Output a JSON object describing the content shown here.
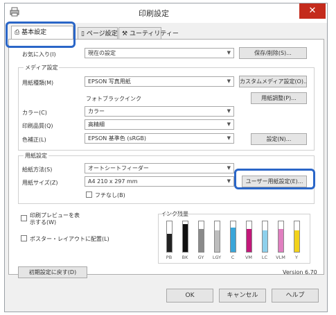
{
  "window": {
    "title": "印刷設定",
    "close_glyph": "✕"
  },
  "tabs": [
    {
      "label": "基本設定"
    },
    {
      "label": "ページ設定"
    },
    {
      "label": "ユーティリティー"
    }
  ],
  "favorites": {
    "label": "お気に入り(I)",
    "value": "現在の設定",
    "button": "保存/削除(S)..."
  },
  "media": {
    "group_title": "メディア設定",
    "paper_type_label": "用紙種類(M)",
    "paper_type_value": "EPSON 写真用紙",
    "custom_button": "カスタムメディア設定(O)...",
    "ink_text": "フォトブラックインク",
    "adjust_button": "用紙調整(P)...",
    "color_label": "カラー(C)",
    "color_value": "カラー",
    "quality_label": "印刷品質(Q)",
    "quality_value": "高精細",
    "mode_label": "色補正(L)",
    "mode_value": "EPSON 基準色 (sRGB)",
    "settings_button": "設定(N)..."
  },
  "paper": {
    "group_title": "用紙設定",
    "source_label": "給紙方法(S)",
    "source_value": "オートシートフィーダー",
    "size_label": "用紙サイズ(Z)",
    "size_value": "A4 210 x 297 mm",
    "user_size_button": "ユーザー用紙設定(E)...",
    "borderless_label": "フチなし(B)",
    "borderless_checked": false
  },
  "options": {
    "preview_label": "印刷プレビューを表示する(W)",
    "layout_label": "ポスター・レイアウトに配置(L)"
  },
  "ink_levels": {
    "title": "インク残量",
    "inks": [
      {
        "name": "PB",
        "color": "#222222",
        "level": 0.6
      },
      {
        "name": "BK",
        "color": "#111111",
        "level": 0.9
      },
      {
        "name": "GY",
        "color": "#8a8a8a",
        "level": 0.75
      },
      {
        "name": "LGY",
        "color": "#bdbdbd",
        "level": 0.7
      },
      {
        "name": "C",
        "color": "#3aa6d9",
        "level": 0.8
      },
      {
        "name": "VM",
        "color": "#c2187a",
        "level": 0.75
      },
      {
        "name": "LC",
        "color": "#8ed0ec",
        "level": 0.7
      },
      {
        "name": "VLM",
        "color": "#e07fc0",
        "level": 0.75
      },
      {
        "name": "Y",
        "color": "#f2d21b",
        "level": 0.7
      }
    ]
  },
  "footer": {
    "reset_button": "初期設定に戻す(D)",
    "version": "Version 6.70",
    "ok": "OK",
    "cancel": "キャンセル",
    "help": "ヘルプ"
  }
}
